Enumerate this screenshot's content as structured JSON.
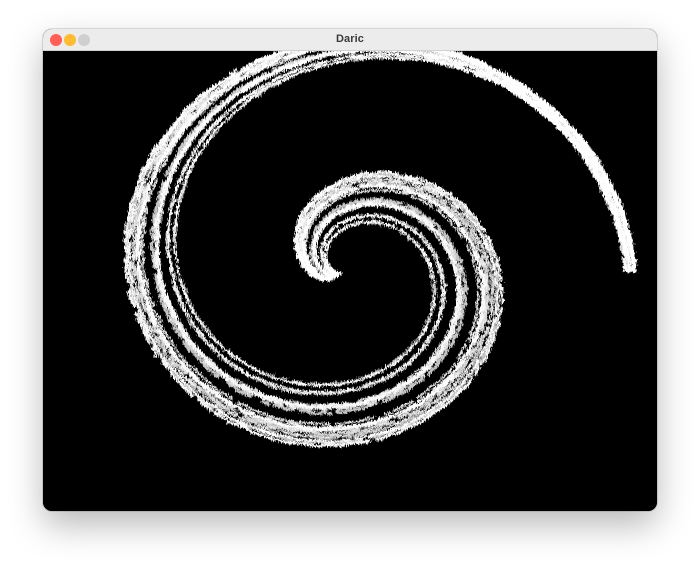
{
  "window": {
    "title": "Daric",
    "controls": {
      "close_color": "#ff5f57",
      "minimize_color": "#febc2e",
      "zoom_color": "#cfcfcf"
    }
  },
  "canvas": {
    "background_color": "#000000",
    "ink_color": "#ffffff"
  }
}
